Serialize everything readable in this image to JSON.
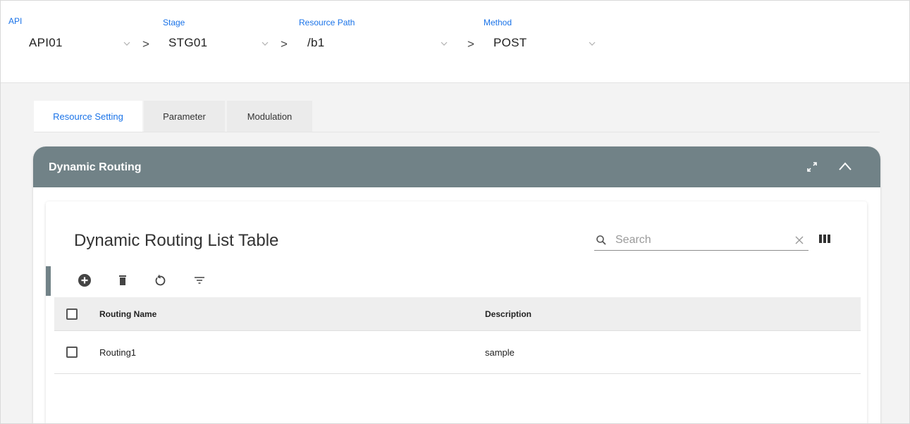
{
  "selectors": {
    "api": {
      "label": "API",
      "value": "API01"
    },
    "stage": {
      "label": "Stage",
      "value": "STG01"
    },
    "resource_path": {
      "label": "Resource Path",
      "value": "/b1"
    },
    "method": {
      "label": "Method",
      "value": "POST"
    },
    "separator": ">"
  },
  "tabs": [
    {
      "label": "Resource Setting",
      "active": true
    },
    {
      "label": "Parameter",
      "active": false
    },
    {
      "label": "Modulation",
      "active": false
    }
  ],
  "panel": {
    "title": "Dynamic Routing",
    "table_title": "Dynamic Routing List Table",
    "search_placeholder": "Search",
    "columns": [
      "Routing Name",
      "Description"
    ],
    "rows": [
      {
        "routing_name": "Routing1",
        "description": "sample"
      }
    ]
  },
  "colors": {
    "accent": "#1a73e8",
    "panel_header": "#718287"
  },
  "icons": {
    "toolbar": [
      "add-circle-icon",
      "delete-icon",
      "refresh-icon",
      "filter-icon"
    ],
    "panel_header": [
      "expand-icon",
      "collapse-icon"
    ]
  }
}
